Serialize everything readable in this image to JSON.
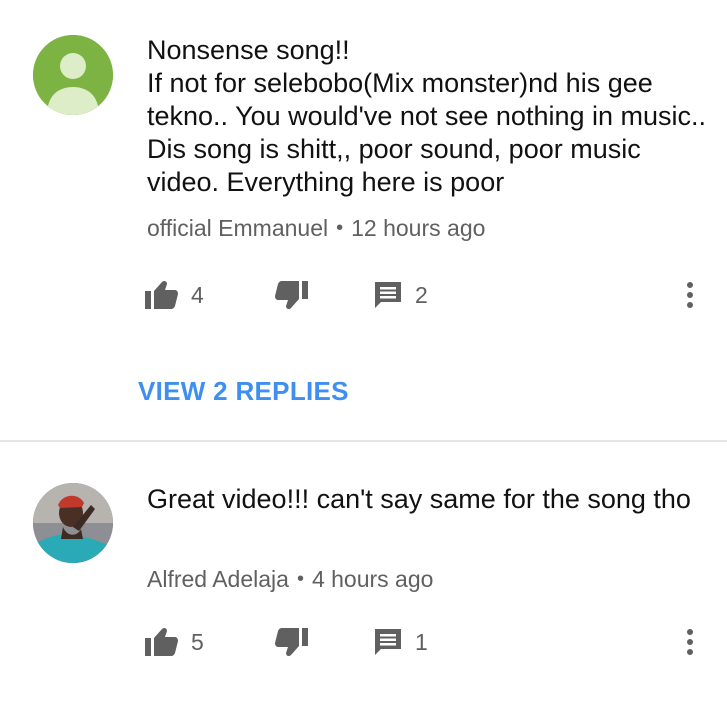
{
  "comments": [
    {
      "text": "Nonsense song!!\nIf not for selebobo(Mix monster)nd his gee tekno.. You would've not see nothing in music.. Dis song is shitt,, poor sound, poor music video. Everything here is poor",
      "author": "official Emmanuel",
      "separator": "•",
      "time": "12 hours ago",
      "likes": "4",
      "replies_count": "2",
      "view_replies": "VIEW 2 REPLIES",
      "avatar_color": "#7cb342"
    },
    {
      "text": "Great video!!! can't say same for the song tho",
      "author": "Alfred Adelaja",
      "separator": "•",
      "time": "4 hours ago",
      "likes": "5",
      "replies_count": "1"
    }
  ],
  "icons": {
    "like": "thumbs-up-icon",
    "dislike": "thumbs-down-icon",
    "reply": "comment-icon",
    "more": "more-vertical-icon"
  },
  "colors": {
    "link": "#3e8ff0",
    "meta": "#606060",
    "divider": "#e5e5e5"
  }
}
